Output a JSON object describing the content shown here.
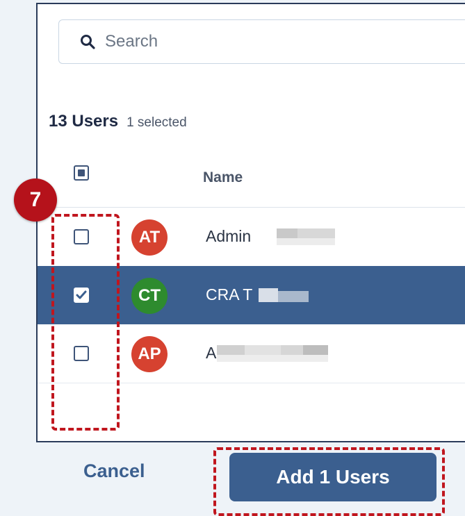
{
  "search": {
    "placeholder": "Search"
  },
  "list": {
    "count_label": "13 Users",
    "selected_label": "1 selected",
    "name_header": "Name"
  },
  "users": [
    {
      "initials": "AT",
      "name": "Admin",
      "avatar_color": "#d64230",
      "checked": false
    },
    {
      "initials": "CT",
      "name": "CRA T",
      "avatar_color": "#2e8b2e",
      "checked": true
    },
    {
      "initials": "AP",
      "name": "A",
      "avatar_color": "#d64230",
      "checked": false
    }
  ],
  "footer": {
    "cancel_label": "Cancel",
    "add_label": "Add 1 Users"
  },
  "annotation": {
    "step_number": "7"
  },
  "colors": {
    "accent": "#3b5f8f",
    "callout": "#b5121b"
  }
}
